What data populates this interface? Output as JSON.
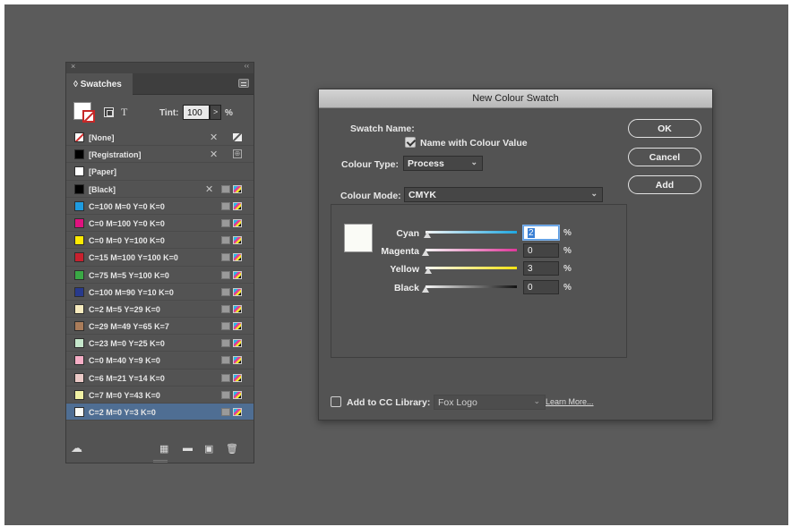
{
  "swatches_panel": {
    "tab_label": "Swatches",
    "tint_label": "Tint:",
    "tint_value": "100",
    "tint_arrow": ">",
    "tint_unit": "%",
    "t_glyph": "T",
    "swatches": [
      {
        "name": "[None]",
        "color": "none"
      },
      {
        "name": "[Registration]",
        "color": "#000000"
      },
      {
        "name": "[Paper]",
        "color": "#ffffff"
      },
      {
        "name": "[Black]",
        "color": "#000000"
      },
      {
        "name": "C=100 M=0 Y=0 K=0",
        "color": "#1e9be0"
      },
      {
        "name": "C=0 M=100 Y=0 K=0",
        "color": "#e0127f"
      },
      {
        "name": "C=0 M=0 Y=100 K=0",
        "color": "#ffea00"
      },
      {
        "name": "C=15 M=100 Y=100 K=0",
        "color": "#c8202e"
      },
      {
        "name": "C=75 M=5 Y=100 K=0",
        "color": "#3aa845"
      },
      {
        "name": "C=100 M=90 Y=10 K=0",
        "color": "#283a8c"
      },
      {
        "name": "C=2 M=5 Y=29 K=0",
        "color": "#f8ecbf"
      },
      {
        "name": "C=29 M=49 Y=65 K=7",
        "color": "#a97c5a"
      },
      {
        "name": "C=23 M=0 Y=25 K=0",
        "color": "#c5e6cb"
      },
      {
        "name": "C=0 M=40 Y=9 K=0",
        "color": "#f6aec6"
      },
      {
        "name": "C=6 M=21 Y=14 K=0",
        "color": "#eccac7"
      },
      {
        "name": "C=7 M=0 Y=43 K=0",
        "color": "#f1f1a4"
      },
      {
        "name": "C=2 M=0 Y=3 K=0",
        "color": "#fafbf6"
      }
    ],
    "selected_index": 16
  },
  "dialog": {
    "title": "New Colour Swatch",
    "swatch_name_label": "Swatch Name:",
    "name_with_value_label": "Name with Colour Value",
    "name_with_value_checked": true,
    "colour_type_label": "Colour Type:",
    "colour_type_value": "Process",
    "colour_mode_label": "Colour Mode:",
    "colour_mode_value": "CMYK",
    "preview_color": "#fafbf6",
    "sliders": [
      {
        "label": "Cyan",
        "value": "2",
        "unit": "%",
        "gradient": "linear-gradient(90deg,#f5f5f5,#1ea7e1)",
        "fraction": 0.02
      },
      {
        "label": "Magenta",
        "value": "0",
        "unit": "%",
        "gradient": "linear-gradient(90deg,#f5f5f5,#e0379a)",
        "fraction": 0.0
      },
      {
        "label": "Yellow",
        "value": "3",
        "unit": "%",
        "gradient": "linear-gradient(90deg,#f5f5f5,#f7e313)",
        "fraction": 0.03
      },
      {
        "label": "Black",
        "value": "0",
        "unit": "%",
        "gradient": "linear-gradient(90deg,#f5f5f5,#111111)",
        "fraction": 0.0
      }
    ],
    "buttons": {
      "ok": "OK",
      "cancel": "Cancel",
      "add": "Add"
    },
    "cc_library_label": "Add to CC Library:",
    "cc_library_checked": false,
    "cc_library_value": "Fox Logo",
    "learn_more": "Learn More..."
  }
}
